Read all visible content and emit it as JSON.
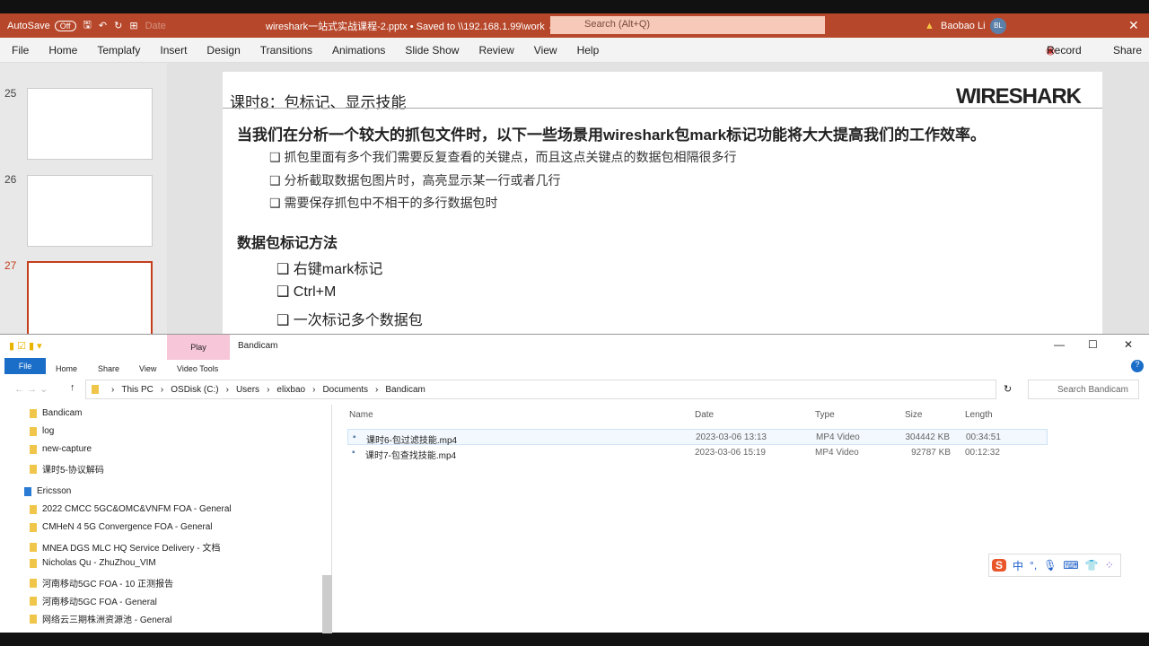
{
  "ppt": {
    "autosave": "AutoSave",
    "autosave_state": "Off",
    "date_label": "Date",
    "doc_title": "wireshark一站式实战课程-2.pptx • Saved to \\\\192.168.1.99\\work ⌄",
    "search_placeholder": "Search (Alt+Q)",
    "user": "Baobao Li",
    "avatar": "BL",
    "record": "Record",
    "share": "Share",
    "tabs": [
      "File",
      "Home",
      "Templafy",
      "Insert",
      "Design",
      "Transitions",
      "Animations",
      "Slide Show",
      "Review",
      "View",
      "Help"
    ],
    "slide_numbers": [
      "25",
      "26",
      "27"
    ]
  },
  "slide": {
    "title": "课时8：包标记、显示技能",
    "logo": "WIRESHARK",
    "lead": "当我们在分析一个较大的抓包文件时，以下一些场景用wireshark包mark标记功能将大大提高我们的工作效率。",
    "bullets": [
      "抓包里面有多个我们需要反复查看的关键点，而且这点关键点的数据包相隔很多行",
      "分析截取数据包图片时，高亮显示某一行或者几行",
      "需要保存抓包中不相干的多行数据包时"
    ],
    "method_heading": "数据包标记方法",
    "methods": [
      "右键mark标记",
      "Ctrl+M",
      "一次标记多个数据包"
    ]
  },
  "explorer": {
    "title": "Bandicam",
    "context_tab": "Play",
    "tabs": [
      "File",
      "Home",
      "Share",
      "View",
      "Video Tools"
    ],
    "breadcrumb": [
      "This PC",
      "OSDisk (C:)",
      "Users",
      "elixbao",
      "Documents",
      "Bandicam"
    ],
    "search_placeholder": "Search Bandicam",
    "nav": [
      "Bandicam",
      "log",
      "new-capture",
      "课时5-协议解码"
    ],
    "nav_group": "Ericsson",
    "nav_group_items": [
      "2022 CMCC 5GC&OMC&VNFM FOA - General",
      "CMHeN 4 5G Convergence FOA - General",
      "MNEA DGS MLC HQ Service Delivery - 文档",
      "Nicholas Qu - ZhuZhou_VIM",
      "河南移动5GC FOA - 10 正测报告",
      "河南移动5GC FOA - General",
      "网络云三期株洲资源池 - General"
    ],
    "columns": [
      "Name",
      "Date",
      "Type",
      "Size",
      "Length"
    ],
    "files": [
      {
        "name": "课时6-包过滤技能.mp4",
        "date": "2023-03-06 13:13",
        "type": "MP4 Video",
        "size": "304442 KB",
        "length": "00:34:51"
      },
      {
        "name": "课时7-包查找技能.mp4",
        "date": "2023-03-06 15:19",
        "type": "MP4 Video",
        "size": "92787 KB",
        "length": "00:12:32"
      }
    ]
  },
  "ime": {
    "lang": "中",
    "punct": "°,"
  }
}
